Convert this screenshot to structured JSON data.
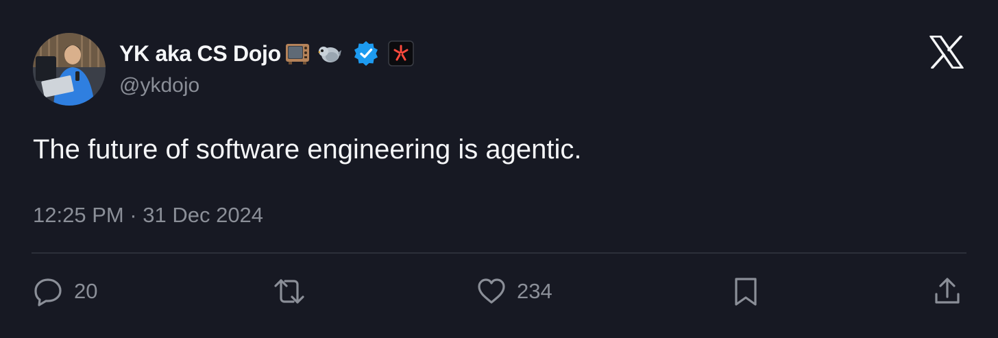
{
  "author": {
    "display_name": "YK aka CS Dojo",
    "handle": "@ykdojo",
    "name_icons": [
      "tv-emoji-icon",
      "bird-emoji-icon",
      "verified-badge-icon",
      "affiliate-badge-icon"
    ]
  },
  "tweet": {
    "text": "The future of software engineering is agentic.",
    "timestamp": "12:25 PM · 31 Dec 2024"
  },
  "actions": {
    "replies": "20",
    "likes": "234"
  },
  "colors": {
    "background": "#171923",
    "text_primary": "#f5f6f8",
    "text_secondary": "#8b8f98",
    "verified_blue": "#1d9bf0",
    "affiliate_red": "#ff4a3d"
  }
}
